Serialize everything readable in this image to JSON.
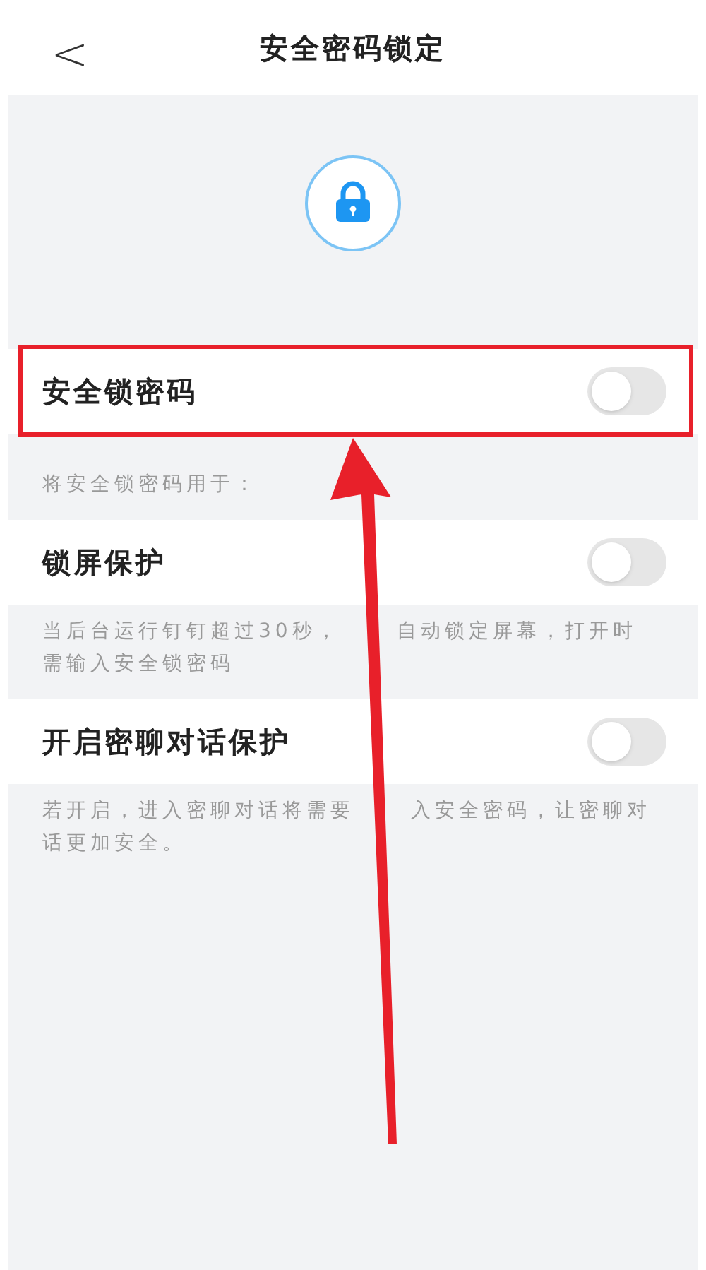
{
  "header": {
    "back": "<",
    "title": "安全密码锁定"
  },
  "master": {
    "label": "安全锁密码",
    "on": false
  },
  "section_caption": "将安全锁密码用于：",
  "options": [
    {
      "label": "锁屏保护",
      "on": false,
      "description_lines": [
        [
          "当后台运行钉钉超过30秒，",
          "自动锁定屏幕，打开时"
        ],
        [
          "需输入安全锁密码"
        ]
      ]
    },
    {
      "label": "开启密聊对话保护",
      "on": false,
      "description_lines": [
        [
          "若开启，进入密聊对话将需要",
          "入安全密码，让密聊对"
        ],
        [
          "话更加安全。"
        ]
      ]
    }
  ]
}
